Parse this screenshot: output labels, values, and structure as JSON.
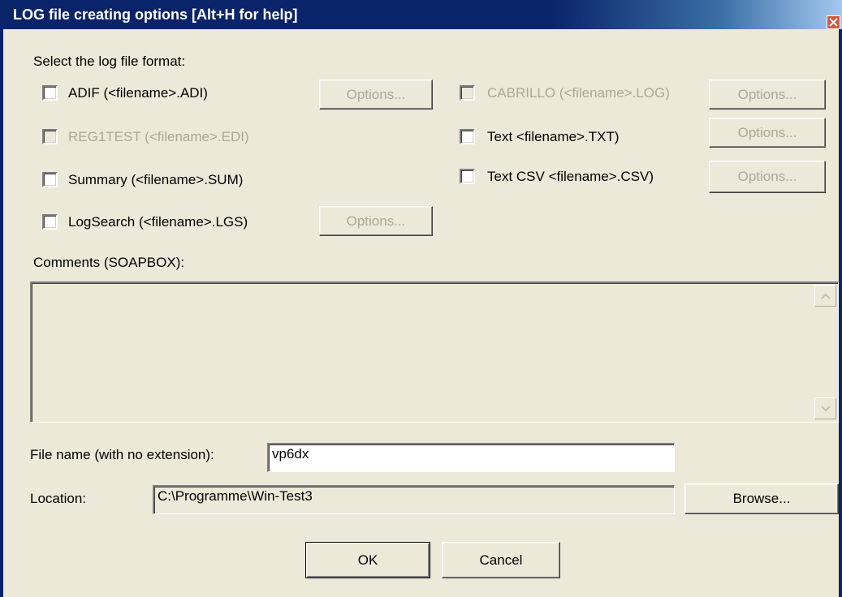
{
  "window": {
    "title": "LOG file creating options [Alt+H for help]"
  },
  "format_label": "Select the log file format:",
  "formats_left": [
    {
      "label": "ADIF (<filename>.ADI)",
      "options_label": "Options...",
      "checked": false,
      "enabled": true
    },
    {
      "label": "REG1TEST (<filename>.EDI)",
      "checked": false,
      "enabled": false
    },
    {
      "label": "Summary (<filename>.SUM)",
      "checked": false,
      "enabled": true
    },
    {
      "label": "LogSearch (<filename>.LGS)",
      "options_label": "Options...",
      "checked": false,
      "enabled": true
    }
  ],
  "formats_right": [
    {
      "label": "CABRILLO (<filename>.LOG)",
      "options_label": "Options...",
      "checked": false,
      "enabled": false
    },
    {
      "label": "Text <filename>.TXT)",
      "options_label": "Options...",
      "checked": false,
      "enabled": true
    },
    {
      "label": "Text CSV <filename>.CSV)",
      "options_label": "Options...",
      "checked": false,
      "enabled": true
    }
  ],
  "comments": {
    "label": "Comments (SOAPBOX):",
    "value": ""
  },
  "filename": {
    "label": "File name (with no extension):",
    "value": "vp6dx"
  },
  "location": {
    "label": "Location:",
    "value": "C:\\Programme\\Win-Test3",
    "browse_label": "Browse..."
  },
  "buttons": {
    "ok": "OK",
    "cancel": "Cancel"
  },
  "colors": {
    "title_bar": "#0a246a",
    "dialog_bg": "#ece9d8",
    "disabled_text": "#aca899",
    "close_button": "#d2593d"
  },
  "icons": {
    "close": "close-icon",
    "scroll_up": "chevron-up-icon",
    "scroll_down": "chevron-down-icon"
  }
}
